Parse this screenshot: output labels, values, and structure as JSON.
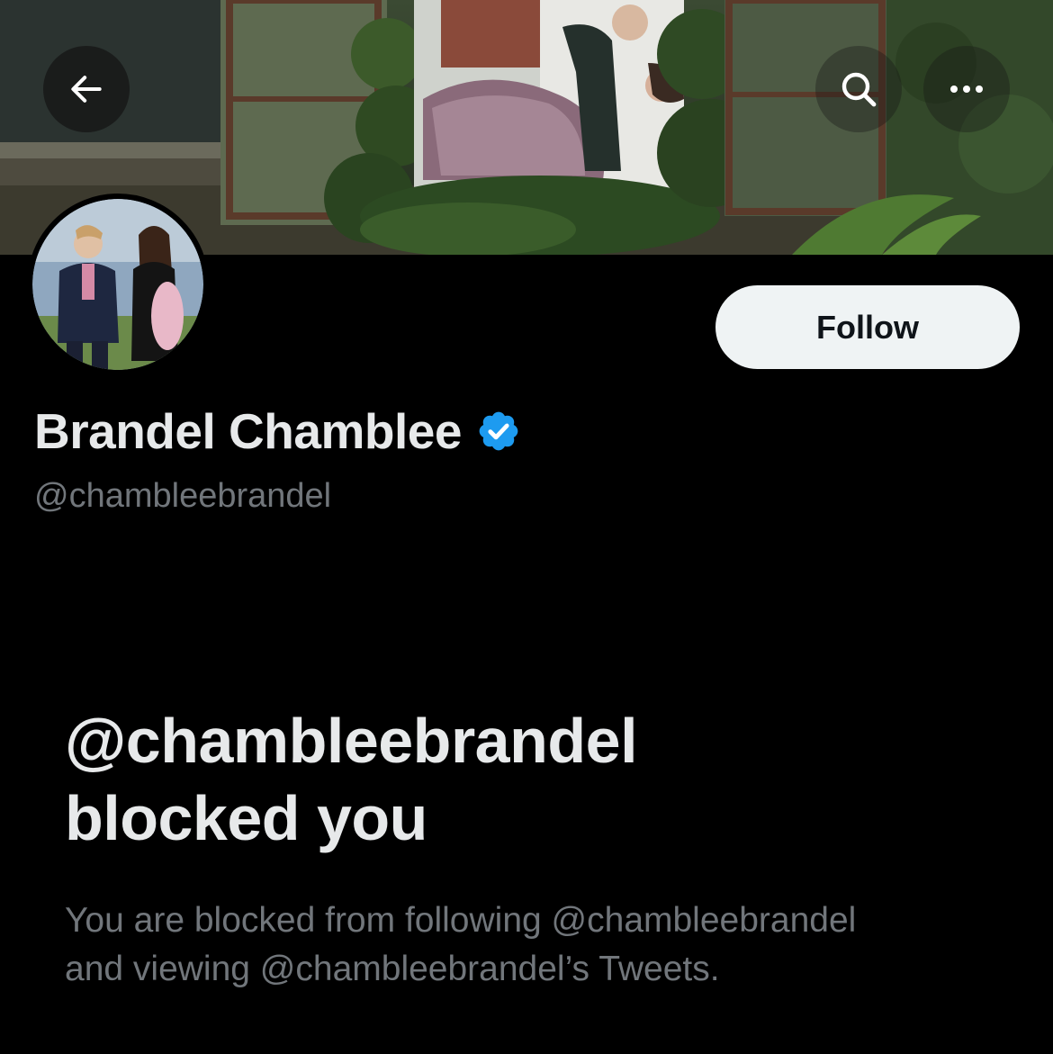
{
  "header": {
    "back_icon": "arrow-left-icon",
    "search_icon": "search-icon",
    "more_icon": "more-horizontal-icon"
  },
  "profile": {
    "display_name": "Brandel Chamblee",
    "verified": true,
    "handle": "@chambleebrandel",
    "follow_label": "Follow"
  },
  "blocked": {
    "title_line1": "@chambleebrandel",
    "title_line2": "blocked you",
    "description_line1": "You are blocked from following @chambleebrandel",
    "description_line2": "and viewing @chambleebrandel’s Tweets."
  },
  "colors": {
    "background": "#000000",
    "primary_text": "#e7e9ea",
    "secondary_text": "#71767b",
    "verified_blue": "#1d9bf0",
    "follow_button_bg": "#eff3f4"
  }
}
